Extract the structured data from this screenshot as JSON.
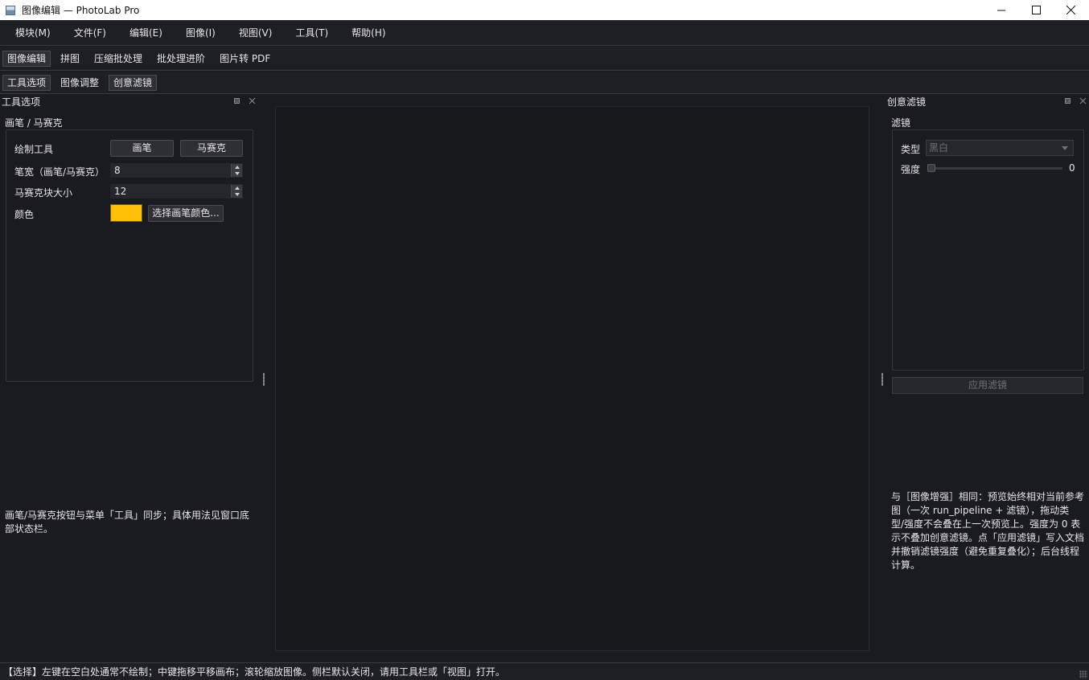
{
  "window": {
    "title": "图像编辑 — PhotoLab Pro"
  },
  "menubar": {
    "items": [
      "模块(M)",
      "文件(F)",
      "编辑(E)",
      "图像(I)",
      "视图(V)",
      "工具(T)",
      "帮助(H)"
    ]
  },
  "module_tabs": {
    "items": [
      "图像编辑",
      "拼图",
      "压缩批处理",
      "批处理进阶",
      "图片转 PDF"
    ],
    "active": "图像编辑"
  },
  "panel_tabs": {
    "items": [
      "工具选项",
      "图像调整",
      "创意滤镜"
    ]
  },
  "left_dock": {
    "title": "工具选项",
    "group_title": "画笔 / 马赛克",
    "draw_tool_label": "绘制工具",
    "brush_button": "画笔",
    "mosaic_button": "马赛克",
    "brush_width_label": "笔宽（画笔/马赛克）",
    "brush_width_value": "8",
    "mosaic_block_label": "马赛克块大小",
    "mosaic_block_value": "12",
    "color_label": "颜色",
    "color_value": "#ffc107",
    "pick_color_button": "选择画笔颜色...",
    "note_line1": "画笔/马赛克按钮与菜单「工具」同步；具体用法见窗口底",
    "note_line2": "部状态栏。"
  },
  "right_dock": {
    "title": "创意滤镜",
    "group_title": "滤镜",
    "type_label": "类型",
    "type_value": "黑白",
    "strength_label": "强度",
    "strength_value": "0",
    "apply_button": "应用滤镜",
    "note_lines": [
      "与［图像增强］相同：预览始终相对当前参考",
      "图（一次 run_pipeline + 滤镜），拖动类",
      "型/强度不会叠在上一次预览上。强度为 0 表",
      "示不叠加创意滤镜。点「应用滤镜」写入文档",
      "并撤销滤镜强度（避免重复叠化）；后台线程",
      "计算。"
    ]
  },
  "statusbar": {
    "text": "【选择】左键在空白处通常不绘制；中键拖移平移画布；滚轮缩放图像。侧栏默认关闭，请用工具栏或「视图」打开。"
  }
}
